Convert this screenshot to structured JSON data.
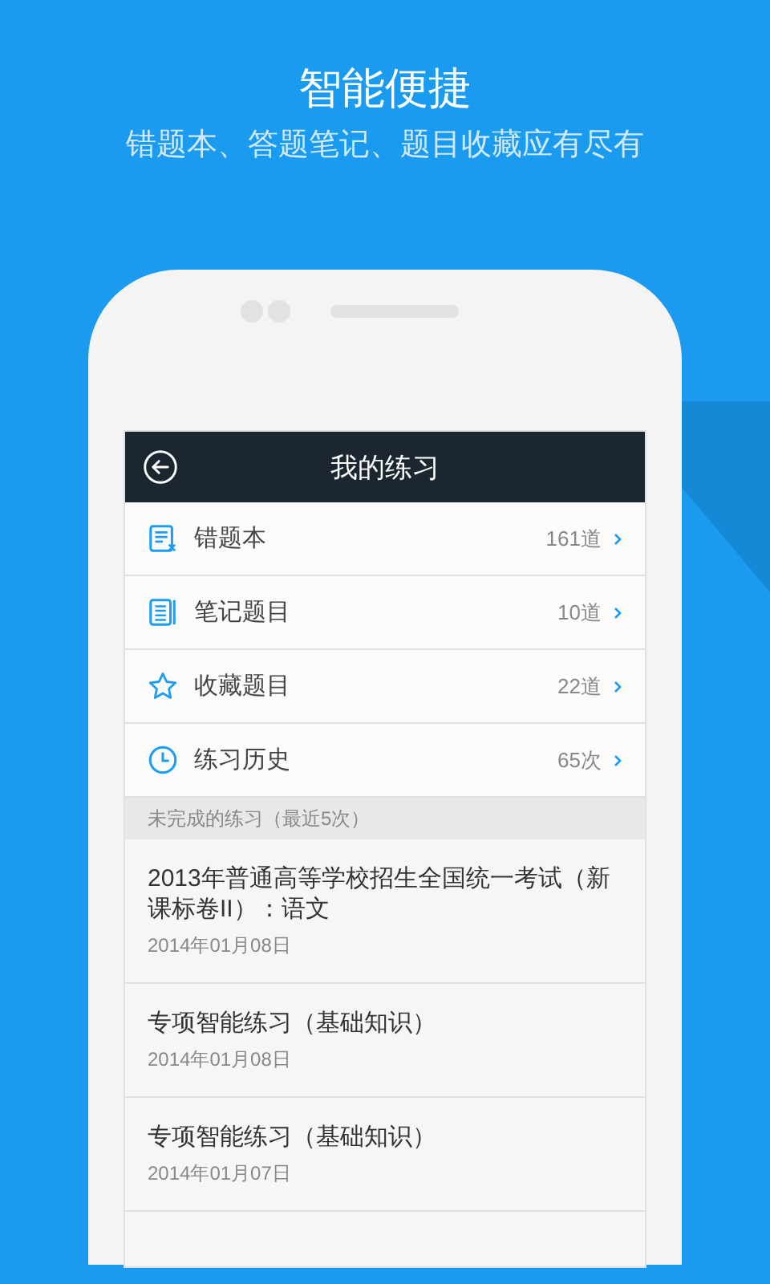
{
  "headline": "智能便捷",
  "subheadline": "错题本、答题笔记、题目收藏应有尽有",
  "screen": {
    "title": "我的练习",
    "menu": [
      {
        "kind": "wrong",
        "label": "错题本",
        "count": "161道"
      },
      {
        "kind": "notes",
        "label": "笔记题目",
        "count": "10道"
      },
      {
        "kind": "star",
        "label": "收藏题目",
        "count": "22道"
      },
      {
        "kind": "clock",
        "label": "练习历史",
        "count": "65次"
      }
    ],
    "section_title": "未完成的练习（最近5次）",
    "exercises": [
      {
        "title": "2013年普通高等学校招生全国统一考试（新课标卷II）：语文",
        "date": "2014年01月08日"
      },
      {
        "title": "专项智能练习（基础知识）",
        "date": "2014年01月08日"
      },
      {
        "title": "专项智能练习（基础知识）",
        "date": "2014年01月07日"
      }
    ]
  }
}
